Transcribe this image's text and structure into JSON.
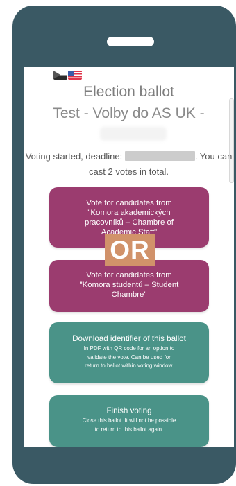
{
  "header": {
    "title": "Election ballot",
    "subtitle": "Test - Volby do AS UK -"
  },
  "status": {
    "prefix": "Voting started, deadline:",
    "suffix": ". You can cast 2 votes in total."
  },
  "cards": {
    "vote_academic": "Vote for candidates from\n\"Komora akademických\npracovníků – Chambre of\nAcademic Staff\"",
    "vote_students": "Vote for candidates from\n\"Komora studentů – Student\nChambre\"",
    "download_title": "Download identifier of this ballot",
    "download_desc": "In PDF with QR code for an option to\nvalidate the vote. Can be used for\nreturn to ballot within voting window.",
    "finish_title": "Finish voting",
    "finish_desc": "Close this ballot. It will not be possible\nto return to this ballot again."
  },
  "overlay": {
    "or_label": "OR"
  },
  "colors": {
    "phone_frame": "#3a5964",
    "vote_button": "#9b3c6f",
    "action_button": "#4a9388",
    "or_badge": "#d1926a"
  },
  "icons": {
    "lang_cz": "czech-flag-icon",
    "lang_en": "us-flag-icon"
  }
}
